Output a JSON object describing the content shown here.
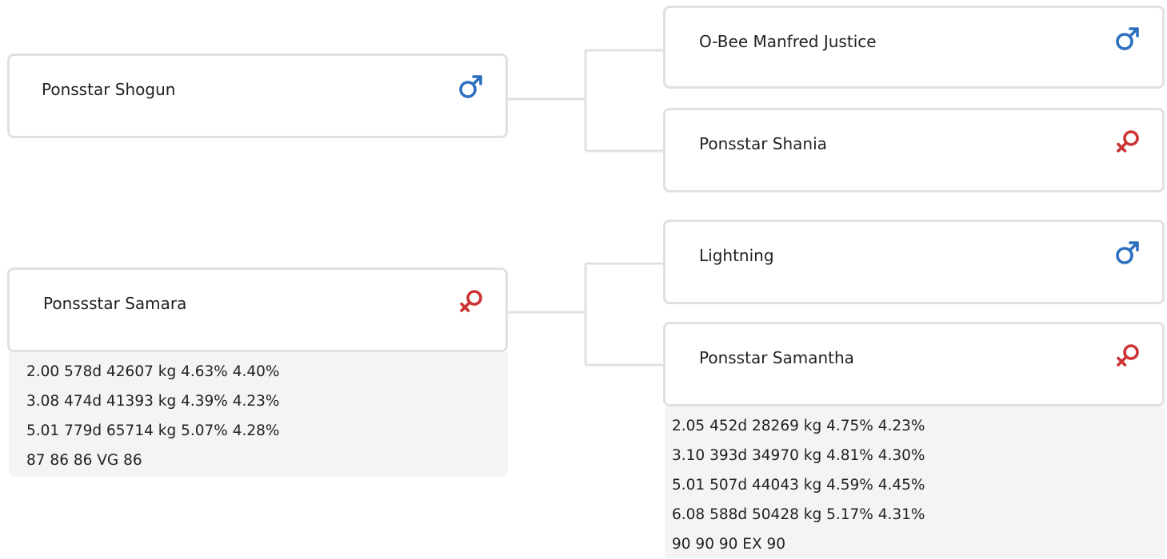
{
  "colors": {
    "male": "#2d6fbf",
    "female": "#cc3333",
    "card_border": "#e1e1e1",
    "connector": "#e1e1e1",
    "stats_bg": "#f4f4f4"
  },
  "pedigree": {
    "sire": {
      "name": "Ponsstar Shogun",
      "sex_icon": "male-icon",
      "sire": {
        "name": "O-Bee Manfred Justice",
        "sex_icon": "male-icon"
      },
      "dam": {
        "name": "Ponsstar Shania",
        "sex_icon": "female-icon"
      }
    },
    "dam": {
      "name": "Ponssstar Samara",
      "sex_icon": "female-icon",
      "stats": [
        "2.00 578d 42607 kg 4.63% 4.40%",
        "3.08 474d 41393 kg 4.39% 4.23%",
        "5.01 779d 65714 kg 5.07% 4.28%",
        "87 86 86 VG 86"
      ],
      "sire": {
        "name": "Lightning",
        "sex_icon": "male-icon"
      },
      "dam": {
        "name": "Ponsstar Samantha",
        "sex_icon": "female-icon",
        "stats": [
          "2.05 452d 28269 kg 4.75% 4.23%",
          "3.10 393d 34970 kg 4.81% 4.30%",
          "5.01 507d 44043 kg 4.59% 4.45%",
          "6.08 588d 50428 kg 5.17% 4.31%",
          "90 90 90 EX 90"
        ]
      }
    }
  }
}
